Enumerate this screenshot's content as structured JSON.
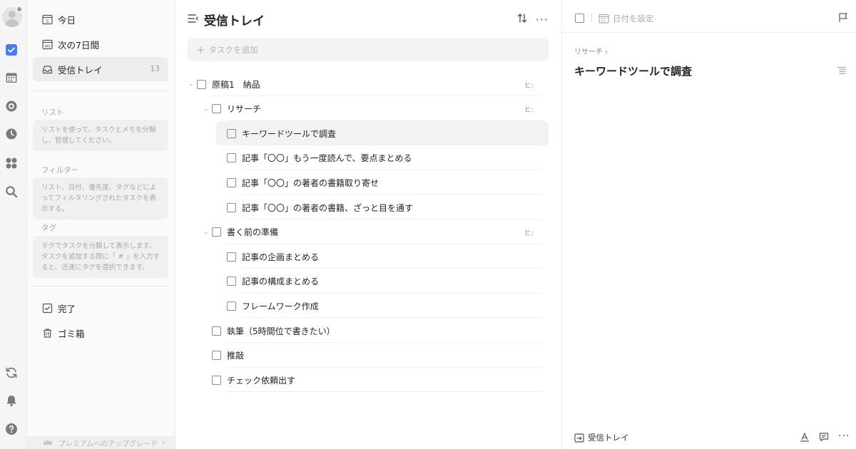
{
  "nav": {
    "today": "今日",
    "today_day": "5",
    "next7": "次の7日間",
    "next7_badge": "We",
    "inbox": "受信トレイ",
    "inbox_count": "13"
  },
  "sections": {
    "list_title": "リスト",
    "list_hint": "リストを使って、タスクとメモを分類し、管理してください。",
    "filter_title": "フィルター",
    "filter_hint": "リスト、日付、優先度、タグなどによってフィルタリングされたタスクを表示する。",
    "tag_title": "タグ",
    "tag_hint": "タグでタスクを分類して表示します。タスクを追加する際に「 # 」を入力すると、迅速にタグを選択できます。"
  },
  "bottom_nav": {
    "done": "完了",
    "trash": "ゴミ箱",
    "upgrade": "プレミアムへのアップグレード"
  },
  "main": {
    "title": "受信トレイ",
    "add_placeholder": "タスクを追加",
    "tasks": [
      {
        "label": "原稿1　納品",
        "level": 0,
        "expand": true,
        "tag": "ヒ:"
      },
      {
        "label": "リサーチ",
        "level": 1,
        "expand": true,
        "tag": "ヒ:"
      },
      {
        "label": "キーワードツールで調査",
        "level": 2,
        "selected": true
      },
      {
        "label": "記事「〇〇」もう一度読んで、要点まとめる",
        "level": 2
      },
      {
        "label": "記事「〇〇」の著者の書籍取り寄せ",
        "level": 2
      },
      {
        "label": "記事「〇〇」の著者の書籍、ざっと目を通す",
        "level": 2
      },
      {
        "label": "書く前の準備",
        "level": 1,
        "expand": true,
        "tag": "ヒ:"
      },
      {
        "label": "記事の企画まとめる",
        "level": 2
      },
      {
        "label": "記事の構成まとめる",
        "level": 2
      },
      {
        "label": "フレームワーク作成",
        "level": 2
      },
      {
        "label": "執筆（5時間位で書きたい）",
        "level": 1
      },
      {
        "label": "推敲",
        "level": 1
      },
      {
        "label": "チェック依頼出す",
        "level": 1
      }
    ]
  },
  "detail": {
    "date_label": "日付を設定",
    "breadcrumb": "リサーチ ›",
    "title": "キーワードツールで調査",
    "footer_list": "受信トレイ"
  },
  "colors": {
    "accent": "#4a7cf0",
    "rail_bg": "#f5f5f5",
    "sidebar_bg": "#fafafa",
    "icon_gray": "#7a7a7a"
  }
}
